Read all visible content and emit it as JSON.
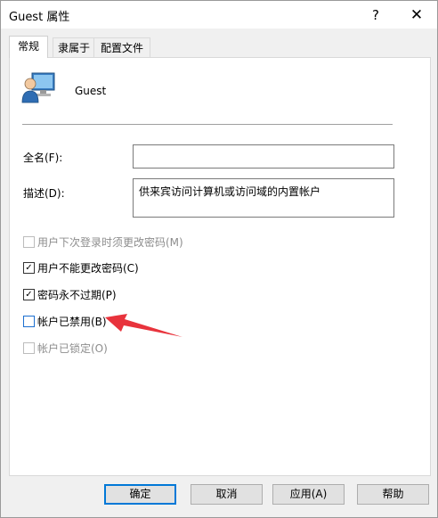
{
  "window": {
    "title": "Guest 属性",
    "help_glyph": "?",
    "close_glyph": "✕"
  },
  "tabs": [
    {
      "label": "常规",
      "active": true
    },
    {
      "label": "隶属于",
      "active": false
    },
    {
      "label": "配置文件",
      "active": false
    }
  ],
  "general": {
    "username": "Guest",
    "fullname_label": "全名(F):",
    "fullname_value": "",
    "description_label": "描述(D):",
    "description_value": "供来宾访问计算机或访问域的内置帐户"
  },
  "options": [
    {
      "label": "用户下次登录时须更改密码(M)",
      "checked": false,
      "enabled": false
    },
    {
      "label": "用户不能更改密码(C)",
      "checked": true,
      "enabled": true
    },
    {
      "label": "密码永不过期(P)",
      "checked": true,
      "enabled": true
    },
    {
      "label": "帐户已禁用(B)",
      "checked": false,
      "enabled": true
    },
    {
      "label": "帐户已锁定(O)",
      "checked": false,
      "enabled": false
    }
  ],
  "annotation": {
    "arrow_color": "#e8333c"
  },
  "buttons": {
    "ok": "确定",
    "cancel": "取消",
    "apply": "应用(A)",
    "help": "帮助"
  },
  "icons": {
    "user": "user-monitor-icon",
    "check": "✓"
  },
  "colors": {
    "accent": "#0078d7"
  }
}
